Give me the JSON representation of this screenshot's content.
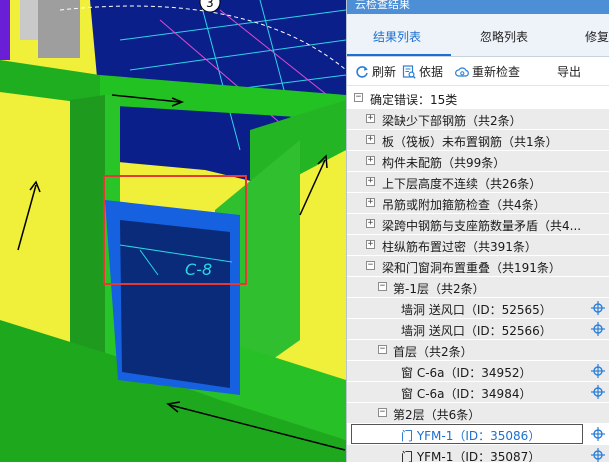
{
  "viewport": {
    "marker_number": "3",
    "wall_tag": "C-8"
  },
  "panel": {
    "title": "云检查结果",
    "tabs": [
      {
        "label": "结果列表",
        "active": true
      },
      {
        "label": "忽略列表",
        "active": false
      },
      {
        "label": "修复",
        "active": false
      }
    ],
    "toolbar": {
      "refresh": "刷新",
      "basis": "依据",
      "recheck": "重新检查",
      "export": "导出"
    },
    "tree": {
      "root": "确定错误：15类",
      "categories": [
        "梁缺少下部钢筋（共2条）",
        "板（筏板）未布置钢筋（共1条）",
        "构件未配筋（共99条）",
        "上下层高度不连续（共26条）",
        "吊筋或附加箍筋检查（共4条）",
        "梁跨中钢筋与支座筋数量矛盾（共4...",
        "柱纵筋布置过密（共391条）"
      ],
      "expanded_category": "梁和门窗洞布置重叠（共191条）",
      "floors": [
        {
          "label": "第-1层（共2条）",
          "items": [
            "墙洞 送风口（ID：52565）",
            "墙洞 送风口（ID：52566）"
          ]
        },
        {
          "label": "首层（共2条）",
          "items": [
            "窗 C-6a（ID：34952）",
            "窗 C-6a（ID：34984）"
          ]
        },
        {
          "label": "第2层（共6条）",
          "items": [
            "门 YFM-1（ID：35086）",
            "门 YFM-1（ID：35087）"
          ]
        }
      ]
    }
  },
  "colors": {
    "selected_text": "#1d6fd1",
    "highlight_box": "#e53935",
    "locate_icon": "#2b7fd8"
  }
}
